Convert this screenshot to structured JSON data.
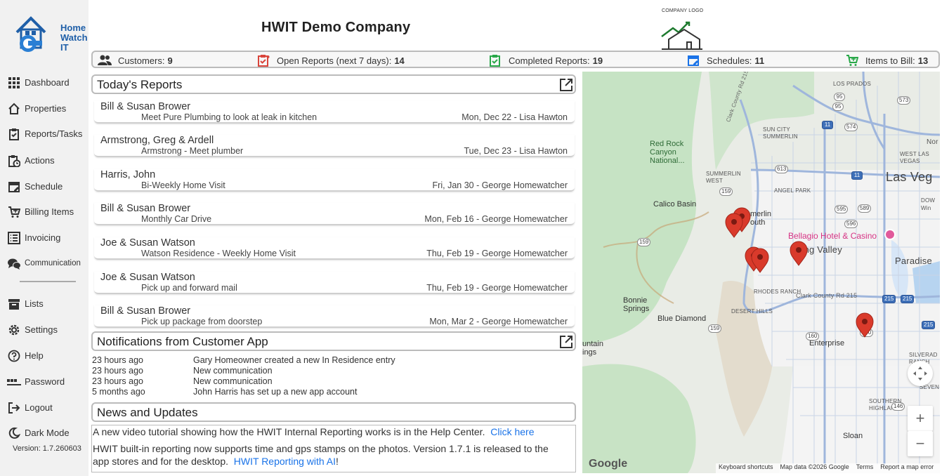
{
  "app": {
    "logo_lines": [
      "Home",
      "Watch",
      "IT"
    ],
    "version": "Version: 1.7.260603"
  },
  "sidebar": {
    "items": [
      {
        "label": "Dashboard",
        "icon": "grid-icon"
      },
      {
        "label": "Properties",
        "icon": "house-icon"
      },
      {
        "label": "Reports/Tasks",
        "icon": "clipboard-check-icon"
      },
      {
        "label": "Actions",
        "icon": "clipboard-clock-icon"
      },
      {
        "label": "Schedule",
        "icon": "calendar-edit-icon"
      },
      {
        "label": "Billing Items",
        "icon": "cart-icon"
      },
      {
        "label": "Invoicing",
        "icon": "list-icon"
      },
      {
        "label": "Communication",
        "icon": "chat-icon"
      },
      {
        "label": "Lists",
        "icon": "archive-icon"
      },
      {
        "label": "Settings",
        "icon": "gear-icon"
      },
      {
        "label": "Help",
        "icon": "help-icon"
      },
      {
        "label": "Password",
        "icon": "password-icon"
      },
      {
        "label": "Logout",
        "icon": "logout-icon"
      },
      {
        "label": "Dark Mode",
        "icon": "moon-icon"
      }
    ]
  },
  "header": {
    "company_name": "HWIT Demo Company",
    "company_logo_caption": "COMPANY LOGO"
  },
  "stats": {
    "customers": {
      "label": "Customers:",
      "value": "9"
    },
    "open_reports": {
      "label": "Open Reports (next 7 days):",
      "value": "14"
    },
    "completed_reports": {
      "label": "Completed Reports:",
      "value": "19"
    },
    "schedules": {
      "label": "Schedules:",
      "value": "11"
    },
    "items_to_bill": {
      "label": "Items to Bill:",
      "value": "13"
    }
  },
  "todays_reports": {
    "title": "Today's Reports",
    "items": [
      {
        "client": "Bill & Susan Brower",
        "task": "Meet Pure Plumbing to look at leak in kitchen",
        "when": "Mon, Dec 22 - Lisa Hawton"
      },
      {
        "client": "Armstrong, Greg & Ardell",
        "task": "Armstrong - Meet plumber",
        "when": "Tue, Dec 23 - Lisa Hawton"
      },
      {
        "client": "Harris, John",
        "task": "Bi-Weekly Home Visit",
        "when": "Fri, Jan 30 - George Homewatcher"
      },
      {
        "client": "Bill & Susan Brower",
        "task": "Monthly Car Drive",
        "when": "Mon, Feb 16 - George Homewatcher"
      },
      {
        "client": "Joe & Susan Watson",
        "task": "Watson Residence - Weekly Home Visit",
        "when": "Thu, Feb 19 - George Homewatcher"
      },
      {
        "client": "Joe & Susan Watson",
        "task": "Pick up and forward mail",
        "when": "Thu, Feb 19 - George Homewatcher"
      },
      {
        "client": "Bill & Susan Brower",
        "task": "Pick up package from doorstep",
        "when": "Mon, Mar 2 - George Homewatcher"
      }
    ]
  },
  "notifications": {
    "title": "Notifications from Customer App",
    "items": [
      {
        "time": "23 hours ago",
        "message": "Gary Homeowner created a new In Residence entry"
      },
      {
        "time": "23 hours ago",
        "message": "New communication"
      },
      {
        "time": "23 hours ago",
        "message": "New communication"
      },
      {
        "time": "5 months ago",
        "message": "John Harris has set up a new app account"
      }
    ]
  },
  "news": {
    "title": "News and Updates",
    "line1_text": "A new video tutorial showing how the HWIT Internal Reporting works is in the Help Center.",
    "line1_link": "Click here",
    "line2_text": "HWIT built-in reporting now supports time and gps stamps on the photos.  Version 1.7.1 is released to the",
    "line3_text": "app stores and for the desktop.",
    "line3_link": "HWIT Reporting with AI",
    "line3_suffix": "!"
  },
  "map": {
    "labels": {
      "las_vegas": "Las Veg",
      "paradise": "Paradise",
      "spring_valley": "ring Valley",
      "enterprise": "Enterprise",
      "bellagio": "Bellagio Hotel & Casino",
      "red_rock": [
        "Red Rock",
        "Canyon",
        "National..."
      ],
      "calico": "Calico Basin",
      "bonnie": [
        "Bonnie",
        "Springs"
      ],
      "blue_diamond": "Blue Diamond",
      "mountain": [
        "untain",
        "ings"
      ],
      "sloan": "Sloan",
      "summerlin_south": [
        "merlin",
        "outh"
      ],
      "los_prados": "LOS PRADOS",
      "sun_city": [
        "SUN CITY",
        "SUMMERLIN"
      ],
      "summerlin_west": [
        "SUMMERLIN",
        "WEST"
      ],
      "angel_park": "ANGEL PARK",
      "west_las_vegas": [
        "WEST LAS",
        "VEGAS"
      ],
      "rhodes_ranch": "RHODES RANCH",
      "desert_hills": "DESERT HILLS",
      "southern_highlands": [
        "SOUTHERN",
        "HIGHLANDS"
      ],
      "silverado": [
        "SILVERAD",
        "RANCH"
      ],
      "seven": "SEVEN",
      "downtown": [
        "DOW",
        "Win"
      ],
      "nor": "Nor",
      "clark_county": "Clark County Rd 215",
      "clark_county_vertical": "Clark County Rd 215"
    },
    "route_shields": [
      "95",
      "573",
      "574",
      "95",
      "11",
      "613",
      "11",
      "159",
      "595",
      "589",
      "596",
      "159",
      "215",
      "215",
      "159",
      "160",
      "160",
      "146",
      "215"
    ],
    "footer": {
      "google": "Google",
      "keyboard": "Keyboard shortcuts",
      "data": "Map data ©2026 Google",
      "terms": "Terms",
      "report": "Report a map error"
    },
    "controls": {
      "zoom_in": "+",
      "zoom_out": "−"
    }
  }
}
